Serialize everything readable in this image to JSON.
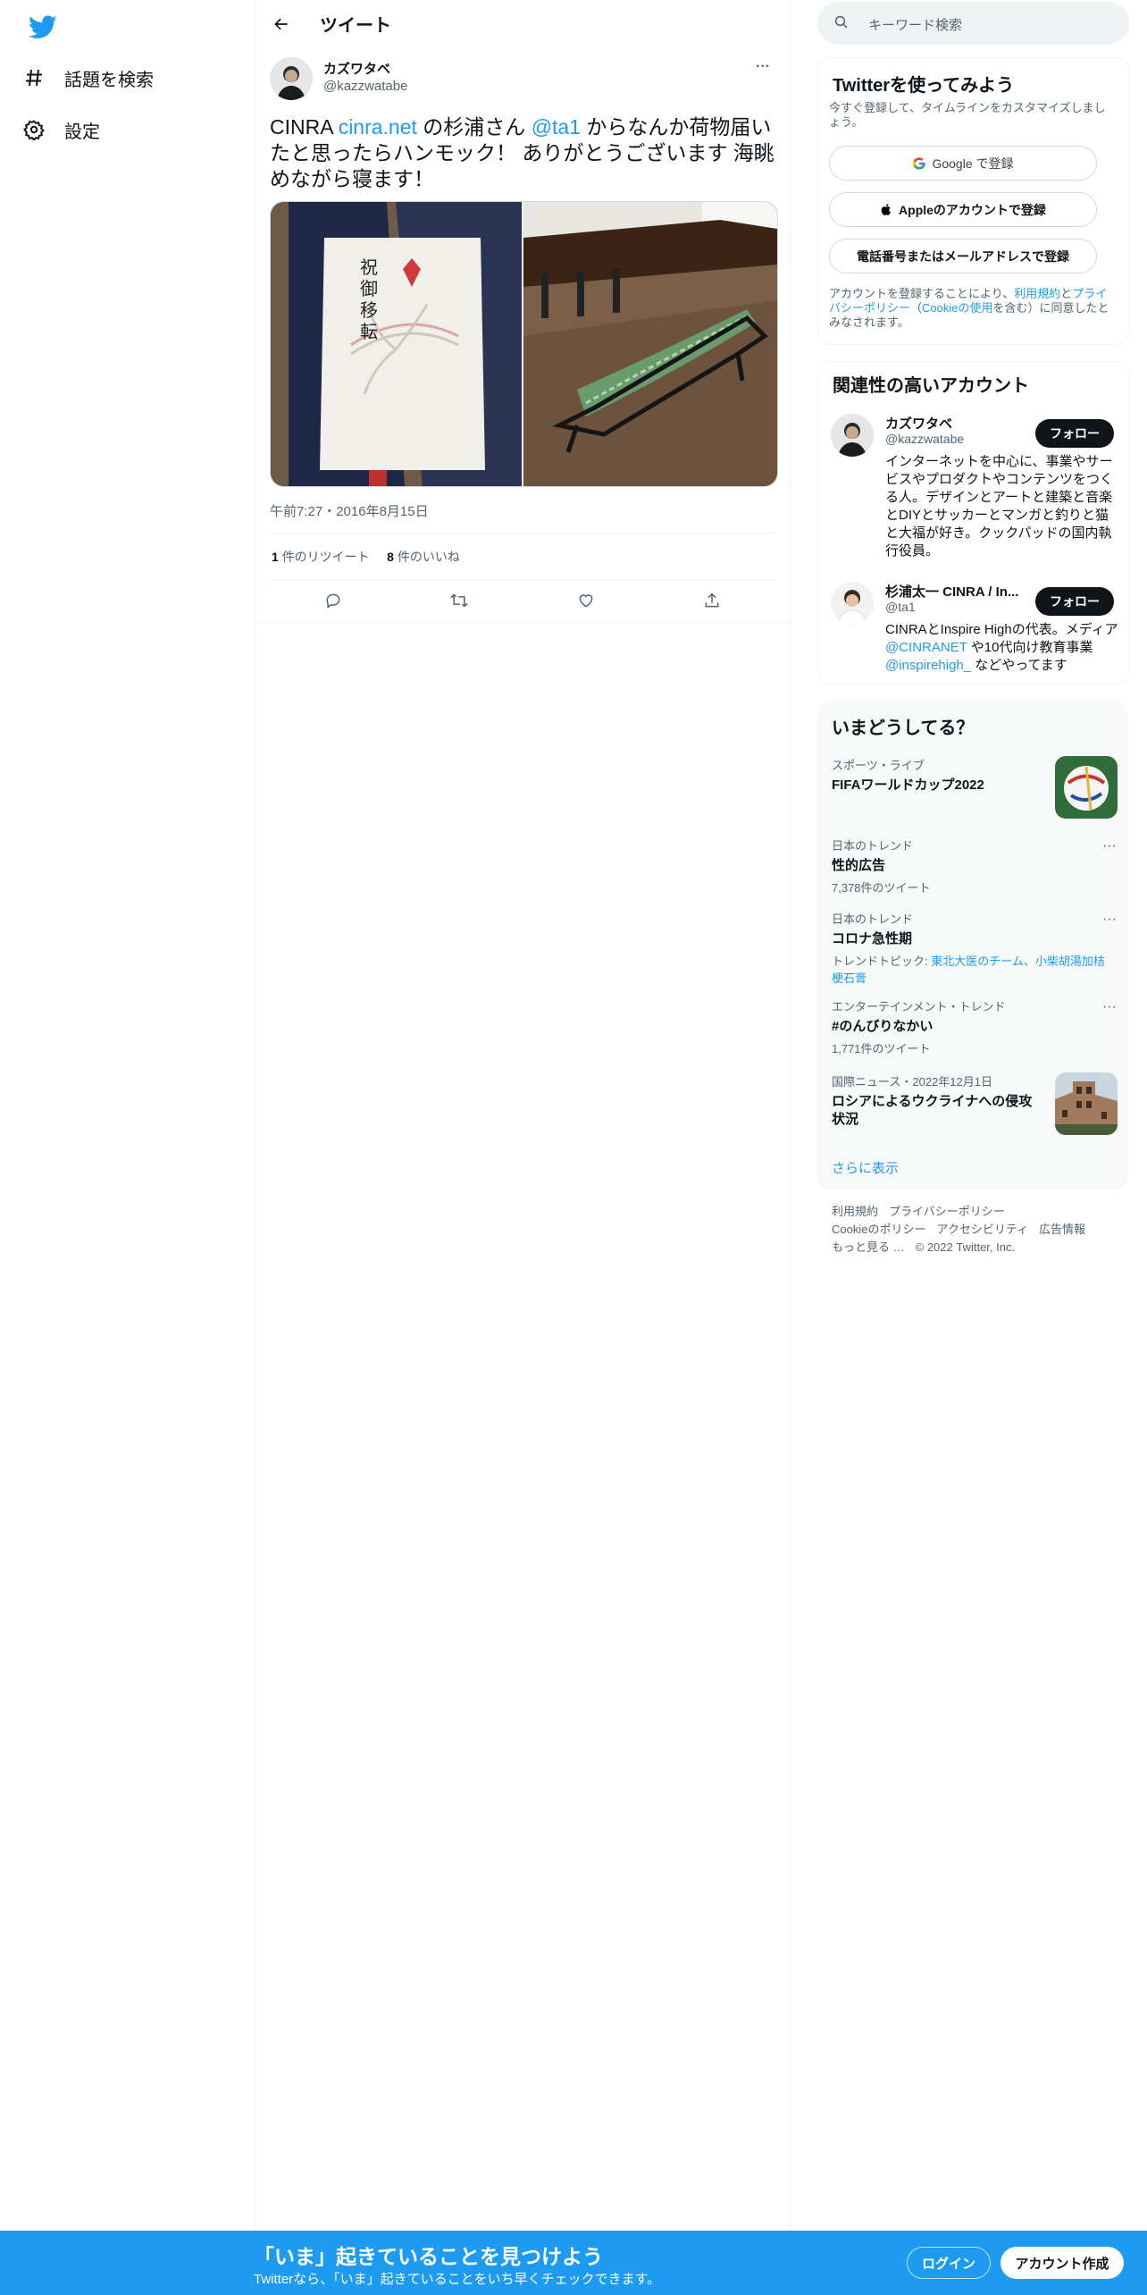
{
  "nav": {
    "explore_label": "話題を検索",
    "settings_label": "設定"
  },
  "header": {
    "title": "ツイート"
  },
  "tweet": {
    "author_name": "カズワタベ",
    "author_handle": "@kazzwatabe",
    "text": {
      "part1": "CINRA ",
      "link1": "cinra.net",
      "part2": " の杉浦さん ",
      "mention": "@ta1",
      "part3": " からなんか荷物届いたと思ったらハンモック！ ありがとうございます 海眺めながら寝ます！"
    },
    "timestamp": "午前7:27・2016年8月15日",
    "retweet_count": "1",
    "retweet_label": "件のリツイート",
    "like_count": "8",
    "like_label": "件のいいね",
    "more_glyph": "···"
  },
  "search": {
    "placeholder": "キーワード検索"
  },
  "signup_card": {
    "title": "Twitterを使ってみよう",
    "subtitle": "今すぐ登録して、タイムラインをカスタマイズしましょう。",
    "google_label": "Google で登録",
    "apple_label": "Appleのアカウントで登録",
    "phone_label": "電話番号またはメールアドレスで登録",
    "legal_prefix": "アカウントを登録することにより、",
    "terms_link": "利用規約",
    "legal_and": "と",
    "privacy_link": "プライバシーポリシー",
    "legal_paren_open": "（",
    "cookie_link": "Cookieの使用",
    "legal_suffix": "を含む）に同意したとみなされます。"
  },
  "relevant": {
    "title": "関連性の高いアカウント",
    "accounts": [
      {
        "name": "カズワタベ",
        "handle": "@kazzwatabe",
        "follow_label": "フォロー",
        "bio": "インターネットを中心に、事業やサービスやプロダクトやコンテンツをつくる人。デザインとアートと建築と音楽とDIYとサッカーとマンガと釣りと猫と大福が好き。クックパッドの国内執行役員。"
      },
      {
        "name": "杉浦太一 CINRA / In...",
        "handle": "@ta1",
        "follow_label": "フォロー",
        "bio_part1": "CINRAとInspire Highの代表。メディア ",
        "bio_link1": "@CINRANET",
        "bio_part2": " や10代向け教育事業 ",
        "bio_link2": "@inspirehigh_",
        "bio_part3": " などやってます"
      }
    ]
  },
  "trends": {
    "title": "いまどうしてる？",
    "items": [
      {
        "category": "スポーツ・ライブ",
        "name": "FIFAワールドカップ2022",
        "count": ""
      },
      {
        "category": "日本のトレンド",
        "name": "性的広告",
        "count": "7,378件のツイート"
      },
      {
        "category": "日本のトレンド",
        "name": "コロナ急性期",
        "topics_label": "トレンドトピック: ",
        "topics": "東北大医のチーム、小柴胡湯加桔梗石膏"
      },
      {
        "category": "エンターテインメント・トレンド",
        "name": "#のんびりなかい",
        "count": "1,771件のツイート"
      },
      {
        "category": "国際ニュース・2022年12月1日",
        "name": "ロシアによるウクライナへの侵攻状況",
        "count": ""
      }
    ],
    "show_more": "さらに表示"
  },
  "footer": {
    "links": [
      "利用規約",
      "プライバシーポリシー",
      "Cookieのポリシー",
      "アクセシビリティ",
      "広告情報",
      "もっと見る …"
    ],
    "copyright": "© 2022 Twitter, Inc."
  },
  "bottom_bar": {
    "title": "「いま」起きていることを見つけよう",
    "subtitle": "Twitterなら、「いま」起きていることをいち早くチェックできます。",
    "login_label": "ログイン",
    "signup_label": "アカウント作成"
  },
  "colors": {
    "accent": "#1d9bf0",
    "text": "#0f1419",
    "muted": "#536471",
    "follow_bg": "#0f1419"
  },
  "icons": [
    "twitter-logo-icon",
    "hashtag-icon",
    "gear-icon",
    "back-arrow-icon",
    "more-icon",
    "reply-icon",
    "retweet-icon",
    "like-icon",
    "share-icon",
    "search-icon",
    "google-icon",
    "apple-icon"
  ]
}
